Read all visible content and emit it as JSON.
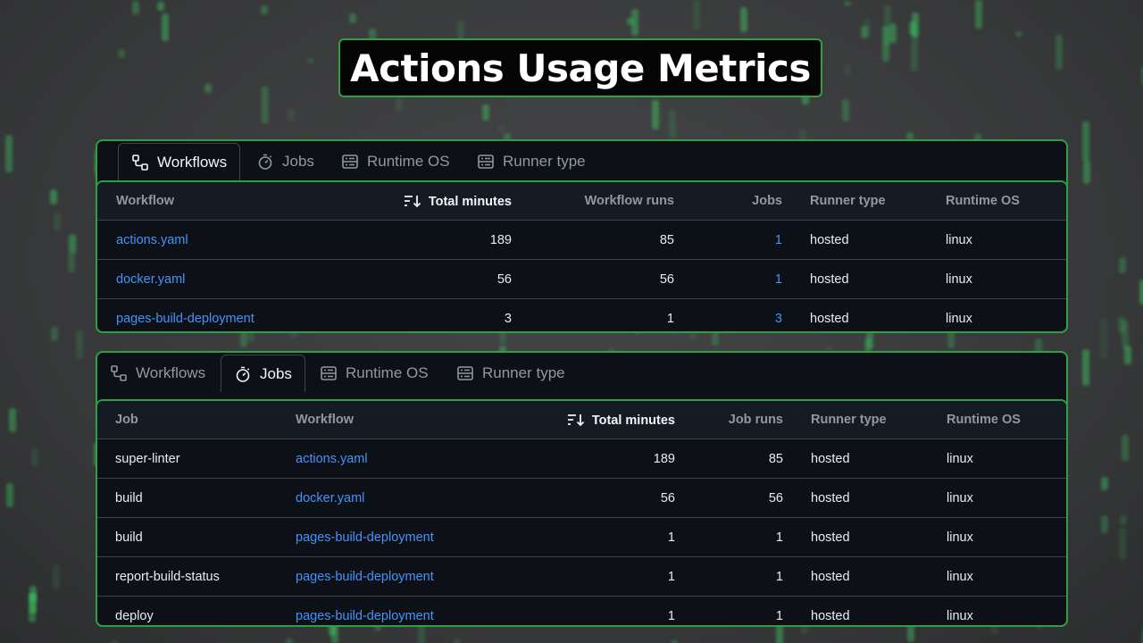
{
  "page_title": "Actions Usage Metrics",
  "colors": {
    "accent_border": "#2ea043",
    "link": "#4493f8",
    "panel_bg": "#0d1117",
    "rain_green": "#3fdc6a"
  },
  "tabs": [
    {
      "label": "Workflows",
      "icon": "workflow-icon"
    },
    {
      "label": "Jobs",
      "icon": "stopwatch-icon"
    },
    {
      "label": "Runtime OS",
      "icon": "server-icon"
    },
    {
      "label": "Runner type",
      "icon": "server-icon"
    }
  ],
  "workflows_panel": {
    "active_tab": "Workflows",
    "headers": [
      "Workflow",
      "Total minutes",
      "Workflow runs",
      "Jobs",
      "Runner type",
      "Runtime OS"
    ],
    "sorted_by": "Total minutes",
    "rows": [
      {
        "workflow": "actions.yaml",
        "total_minutes": "189",
        "workflow_runs": "85",
        "jobs": "1",
        "runner_type": "hosted",
        "runtime_os": "linux"
      },
      {
        "workflow": "docker.yaml",
        "total_minutes": "56",
        "workflow_runs": "56",
        "jobs": "1",
        "runner_type": "hosted",
        "runtime_os": "linux"
      },
      {
        "workflow": "pages-build-deployment",
        "total_minutes": "3",
        "workflow_runs": "1",
        "jobs": "3",
        "runner_type": "hosted",
        "runtime_os": "linux"
      }
    ]
  },
  "jobs_panel": {
    "active_tab": "Jobs",
    "headers": [
      "Job",
      "Workflow",
      "Total minutes",
      "Job runs",
      "Runner type",
      "Runtime OS"
    ],
    "sorted_by": "Total minutes",
    "rows": [
      {
        "job": "super-linter",
        "workflow": "actions.yaml",
        "total_minutes": "189",
        "job_runs": "85",
        "runner_type": "hosted",
        "runtime_os": "linux"
      },
      {
        "job": "build",
        "workflow": "docker.yaml",
        "total_minutes": "56",
        "job_runs": "56",
        "runner_type": "hosted",
        "runtime_os": "linux"
      },
      {
        "job": "build",
        "workflow": "pages-build-deployment",
        "total_minutes": "1",
        "job_runs": "1",
        "runner_type": "hosted",
        "runtime_os": "linux"
      },
      {
        "job": "report-build-status",
        "workflow": "pages-build-deployment",
        "total_minutes": "1",
        "job_runs": "1",
        "runner_type": "hosted",
        "runtime_os": "linux"
      },
      {
        "job": "deploy",
        "workflow": "pages-build-deployment",
        "total_minutes": "1",
        "job_runs": "1",
        "runner_type": "hosted",
        "runtime_os": "linux"
      }
    ]
  }
}
